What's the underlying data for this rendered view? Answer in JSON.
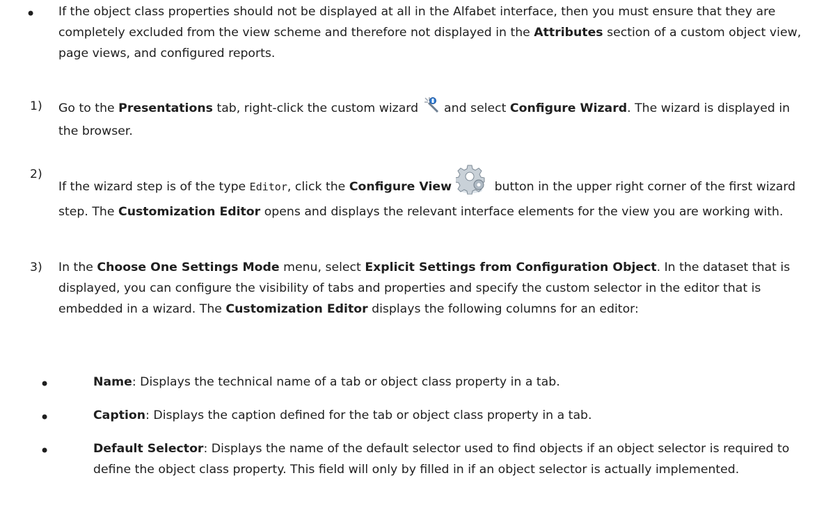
{
  "doc": {
    "intro": {
      "bullet": "•",
      "text1": "If the object class properties should not be displayed at all in the Alfabet interface, then you must ensure that they are completely excluded from the view scheme and therefore not displayed in the ",
      "bold1": "Attributes",
      "text2": " section of a custom object view, page views, and configured reports."
    },
    "steps": [
      {
        "num": "1)",
        "t1": "Go to the ",
        "b1": "Presentations",
        "t2": " tab, right-click the custom wizard ",
        "icon": "wand-icon",
        "t3": " and select ",
        "b2": "Configure Wizard",
        "t4": ". The wizard is displayed in the browser."
      },
      {
        "num": "2)",
        "t1": "If the wizard step is of the type ",
        "code": "Editor",
        "t2": ", click the ",
        "b1": "Configure View",
        "icon": "gear-icon",
        "t3": " button in the upper right corner of the first wizard step. The ",
        "b2": "Customization Editor",
        "t4": " opens and displays the relevant interface elements for the view you are working with."
      },
      {
        "num": "3)",
        "t1": "In the ",
        "b1": "Choose One Settings Mode",
        "t2": " menu, select ",
        "b2": "Explicit Settings from Configuration Object",
        "t3": ". In the dataset that is displayed, you can configure the visibility of tabs and properties and specify the custom selector in the editor that is embedded in a wizard. The ",
        "b3": "Customization Editor",
        "t4": " displays the following columns for an editor:"
      }
    ],
    "columns": [
      {
        "bullet": "•",
        "term": "Name",
        "desc": ": Displays the technical name of a tab or object class property in a tab."
      },
      {
        "bullet": "•",
        "term": "Caption",
        "desc": ": Displays the caption defined for the tab or object class property in a tab."
      },
      {
        "bullet": "•",
        "term": "Default Selector",
        "desc": ": Displays the name of the default selector used to find objects if an object selector is required to define the object class property. This field will only by filled in if an object selector is actually implemented."
      }
    ]
  }
}
